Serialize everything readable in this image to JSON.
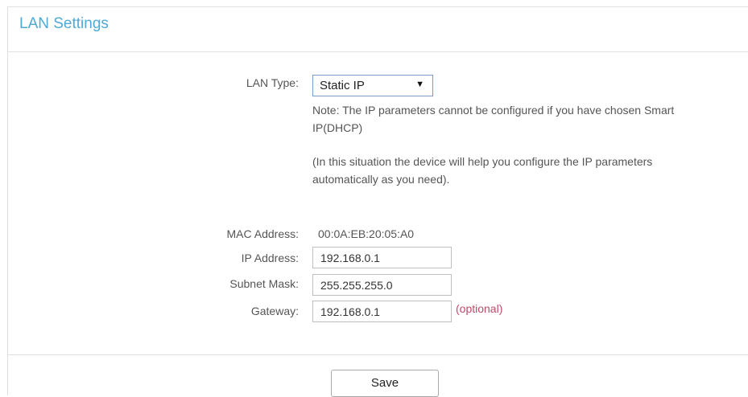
{
  "panel": {
    "title": "LAN Settings"
  },
  "lan_type": {
    "label": "LAN Type:",
    "selected": "Static IP",
    "arrow_icon": "triangle-down",
    "note": "Note: The IP parameters cannot be configured if you have chosen Smart IP(DHCP)",
    "info": "(In this situation the device will help you configure the IP parameters automatically as you need)."
  },
  "mac": {
    "label": "MAC Address:",
    "value": "00:0A:EB:20:05:A0"
  },
  "ip": {
    "label": "IP Address:",
    "value": "192.168.0.1"
  },
  "subnet": {
    "label": "Subnet Mask:",
    "value": "255.255.255.0"
  },
  "gateway": {
    "label": "Gateway:",
    "value": "192.168.0.1",
    "optional": "(optional)"
  },
  "actions": {
    "save_label": "Save"
  },
  "colors": {
    "title": "#4fa9d6",
    "optional": "#c04a6a",
    "select_border": "#7a9cc9"
  }
}
